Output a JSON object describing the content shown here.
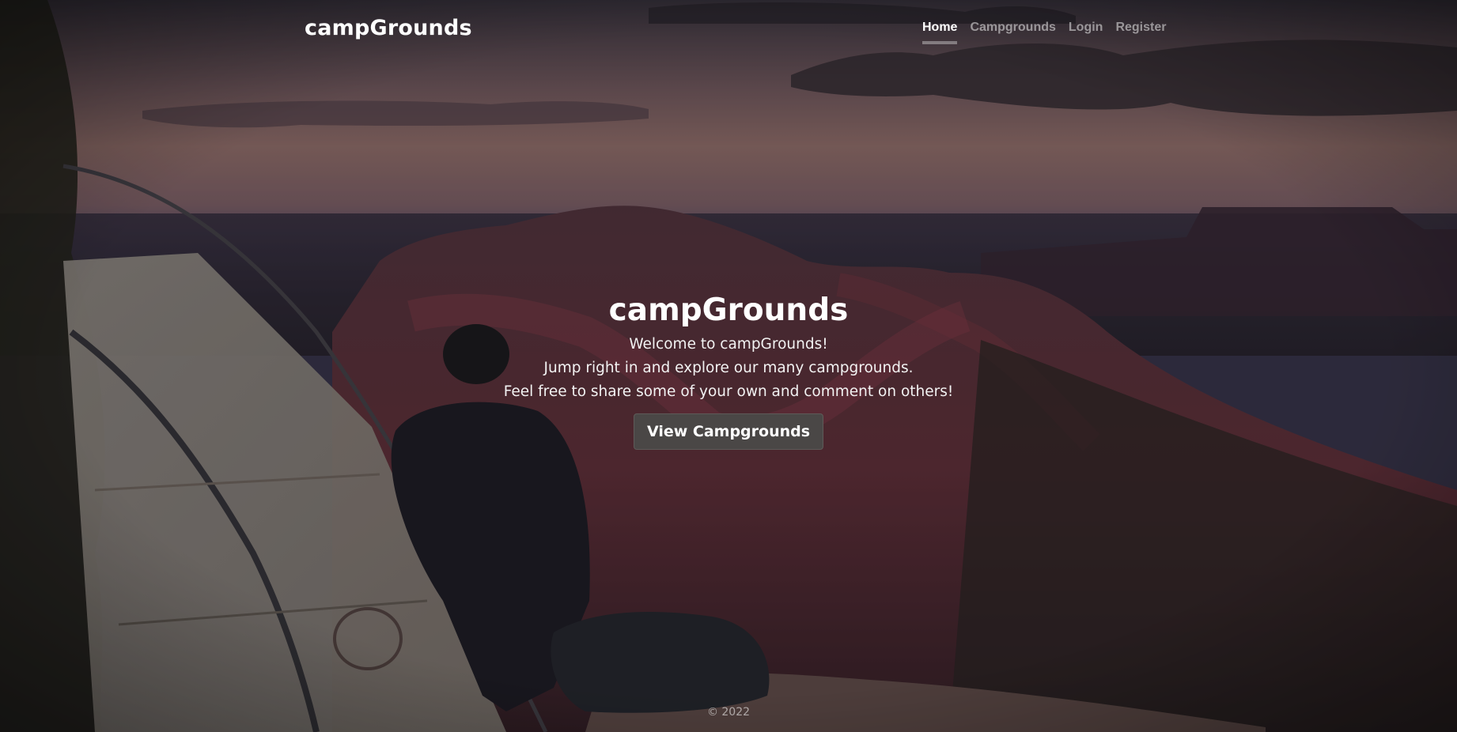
{
  "navbar": {
    "brand": "campGrounds",
    "links": [
      {
        "label": "Home",
        "active": true
      },
      {
        "label": "Campgrounds",
        "active": false
      },
      {
        "label": "Login",
        "active": false
      },
      {
        "label": "Register",
        "active": false
      }
    ]
  },
  "hero": {
    "title": "campGrounds",
    "lines": [
      "Welcome to campGrounds!",
      "Jump right in and explore our many campgrounds.",
      "Feel free to share some of your own and comment on others!"
    ],
    "button_label": "View Campgrounds"
  },
  "footer": {
    "text": "© 2022"
  },
  "colors": {
    "button_bg": "#4a4746",
    "text": "#ffffff",
    "nav_inactive": "rgba(255,255,255,0.5)"
  }
}
